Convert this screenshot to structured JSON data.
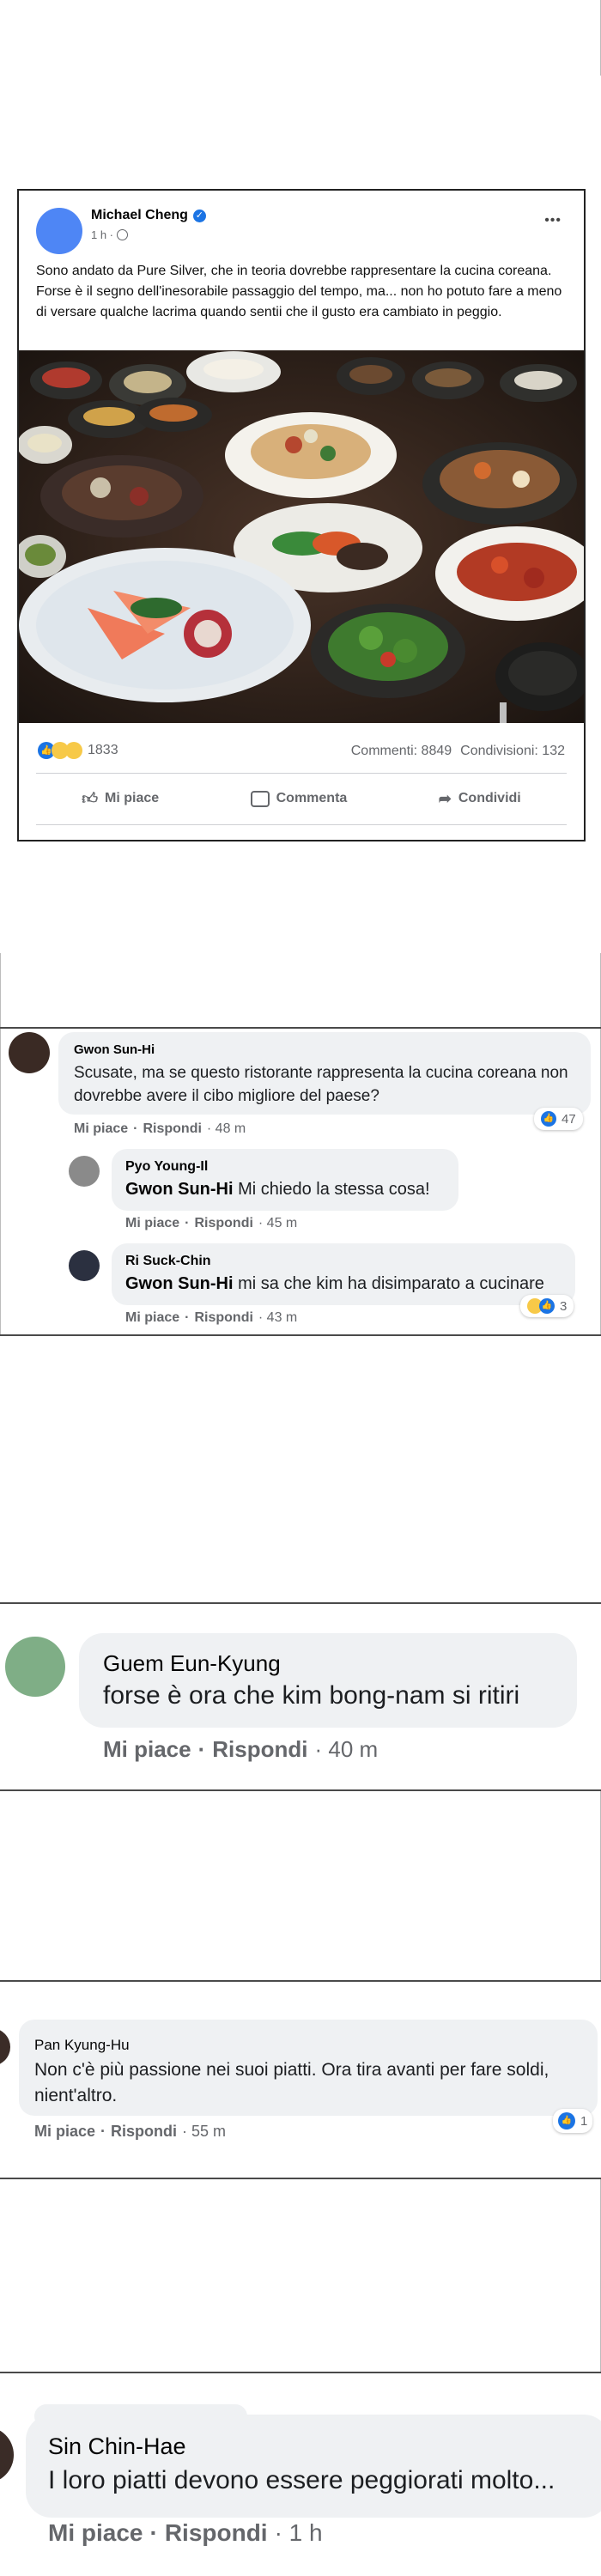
{
  "post": {
    "author": "Michael Cheng",
    "time": "1 h ·",
    "text": "Sono andato da Pure Silver, che in teoria dovrebbe rappresentare la cucina coreana. Forse è il segno dell'inesorabile passaggio del tempo, ma... non ho potuto fare a meno di versare qualche lacrima quando sentii che il gusto era cambiato in peggio.",
    "image_desc": "korean-table-spread",
    "reaction_count": "1833",
    "comments": "Commenti: 8849",
    "shares": "Condivisioni: 132",
    "actions": {
      "like": "Mi piace",
      "comment": "Commenta",
      "share": "Condividi"
    },
    "more": "•••"
  },
  "thread1": {
    "author": "Gwon Sun-Hi",
    "text": "Scusate, ma se questo ristorante rappresenta la cucina coreana non dovrebbe avere il cibo migliore del paese?",
    "like": "Mi piace",
    "reply": "Rispondi",
    "time": "· 48 m",
    "reaction_count": "47",
    "replies": [
      {
        "author": "Pyo Young-Il",
        "mention": "Gwon Sun-Hi",
        "text": " Mi chiedo la stessa cosa!",
        "like": "Mi piace",
        "reply": "Rispondi",
        "time": "· 45 m"
      },
      {
        "author": "Ri Suck-Chin",
        "mention": "Gwon Sun-Hi",
        "text": " mi sa che kim ha disimparato a cucinare",
        "like": "Mi piace",
        "reply": "Rispondi",
        "time": "· 43 m",
        "reaction_count": "3"
      }
    ]
  },
  "comment2": {
    "author": "Guem Eun-Kyung",
    "text": "forse è ora che kim bong-nam si ritiri",
    "like": "Mi piace",
    "reply": "Rispondi",
    "time": "· 40 m"
  },
  "comment3": {
    "author": "Pan Kyung-Hu",
    "text": "Non c'è più passione nei suoi piatti. Ora tira avanti per fare soldi, nient'altro.",
    "like": "Mi piace",
    "reply": "Rispondi",
    "time": "· 55 m",
    "reaction_count": "1"
  },
  "comment4": {
    "author": "Sin Chin-Hae",
    "text": "I loro piatti devono essere peggiorati molto...",
    "like": "Mi piace",
    "reply": "Rispondi",
    "time": "· 1 h"
  },
  "colors": {
    "accent": "#1b74e4",
    "bubble": "#eff1f3",
    "meta": "#65676b"
  }
}
